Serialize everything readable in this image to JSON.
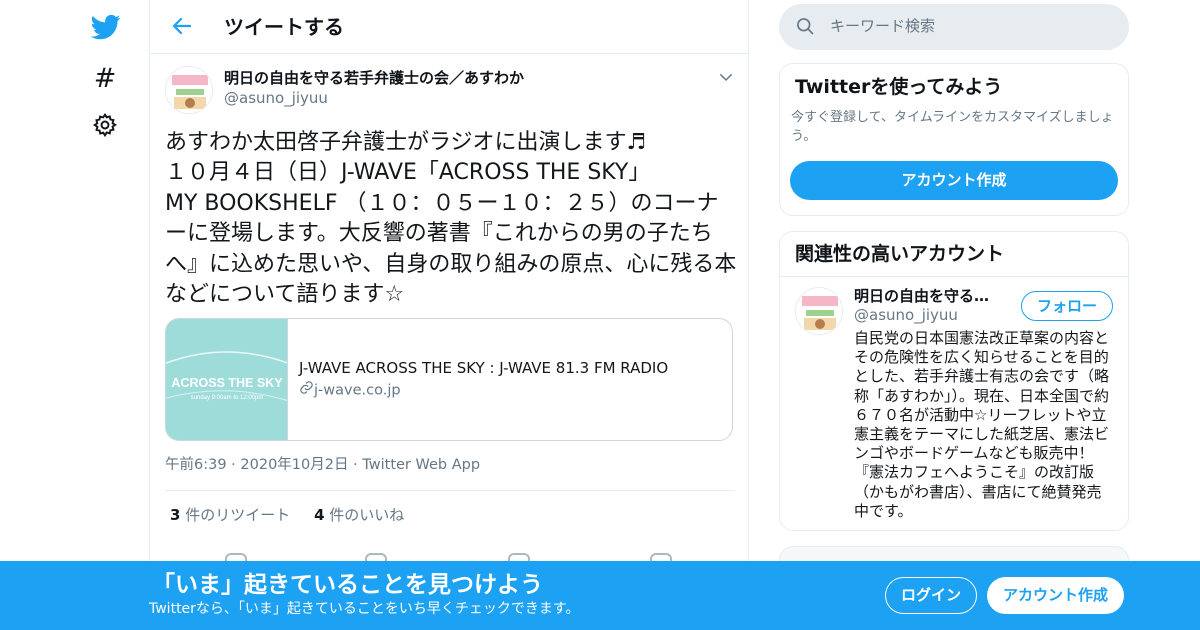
{
  "nav": {
    "twitter_icon": "twitter-bird-icon",
    "explore_icon": "hashtag-icon",
    "settings_icon": "gear-icon"
  },
  "header": {
    "title": "ツイートする"
  },
  "tweet": {
    "author_name": "明日の自由を守る若手弁護士の会／あすわか",
    "author_handle": "@asuno_jiyuu",
    "text": "あすわか太田啓子弁護士がラジオに出演します♬\n１０月４日（日）J-WAVE「ACROSS THE SKY」\nMY BOOKSHELF （１０：０５ー１０：２５）のコーナーに登場します。大反響の著書『これからの男の子たちへ』に込めた思いや、自身の取り組みの原点、心に残る本などについて語ります☆",
    "card": {
      "thumb_title": "ACROSS THE SKY",
      "thumb_subtitle": "sunday 9:00am to 12:00pm",
      "title": "J-WAVE ACROSS THE SKY : J-WAVE 81.3 FM RADIO",
      "domain": "j-wave.co.jp"
    },
    "time": "午前6:39",
    "date": "2020年10月2日",
    "source": "Twitter Web App",
    "retweets_count": "3",
    "retweets_label": "件のリツイート",
    "likes_count": "4",
    "likes_label": "件のいいね"
  },
  "search": {
    "placeholder": "キーワード検索"
  },
  "signup_panel": {
    "title": "Twitterを使ってみよう",
    "description": "今すぐ登録して、タイムラインをカスタマイズしましょう。",
    "button": "アカウント作成"
  },
  "related": {
    "title": "関連性の高いアカウント",
    "name": "明日の自由を守る若手弁護士の会／あすわか",
    "handle": "@asuno_jiyuu",
    "follow": "フォロー",
    "bio": "自民党の日本国憲法改正草案の内容とその危険性を広く知らせることを目的とした、若手弁護士有志の会です（略称「あすわか」）。現在、日本全国で約６７０名が活動中☆リーフレットや立憲主義をテーマにした紙芝居、憲法ビンゴやボードゲームなども販売中！『憲法カフェへようこそ』の改訂版（かもがわ書店）、書店にて絶賛発売中です。"
  },
  "banner": {
    "title": "「いま」起きていることを見つけよう",
    "subtitle": "Twitterなら、「いま」起きていることをいち早くチェックできます。",
    "login": "ログイン",
    "signup": "アカウント作成"
  },
  "colors": {
    "brand": "#1da1f2",
    "secondary_text": "#657786",
    "border": "#e6ecf0"
  }
}
